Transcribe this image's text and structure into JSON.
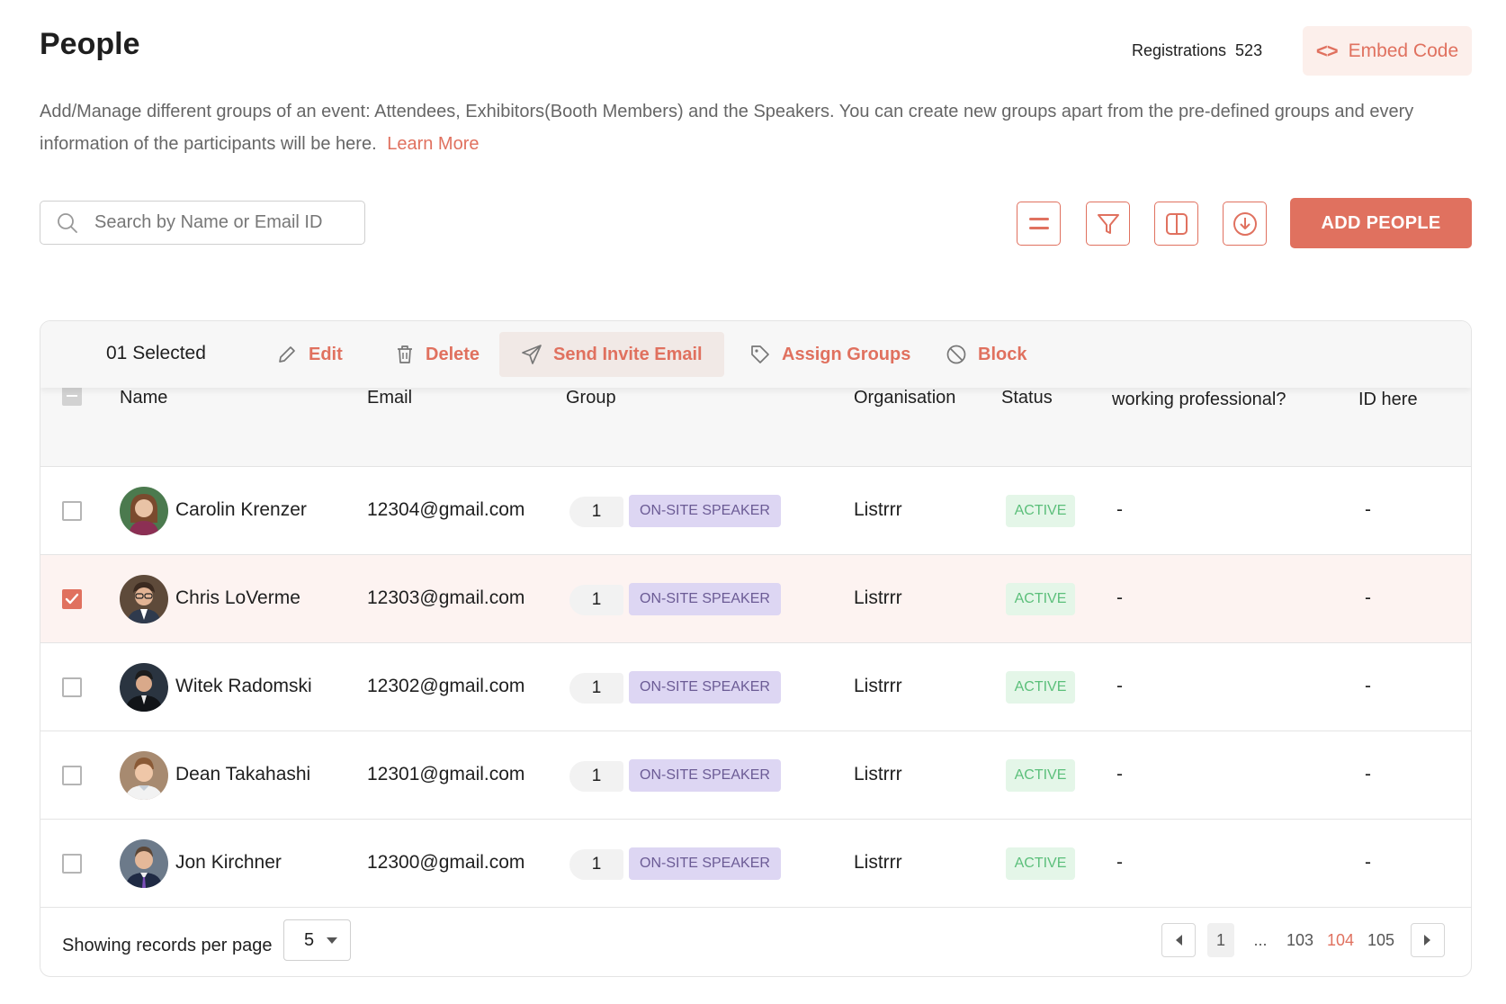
{
  "header": {
    "title": "People",
    "registrations_label": "Registrations",
    "registrations_count": "523",
    "embed_label": "Embed Code"
  },
  "description": {
    "text": "Add/Manage different groups of an event: Attendees, Exhibitors(Booth Members) and the Speakers. You can create new groups apart from the pre-defined groups and every information of the participants will be here.",
    "link": "Learn More"
  },
  "toolbar": {
    "search_placeholder": "Search by Name or Email ID",
    "icons": [
      "density-icon",
      "filter-icon",
      "columns-icon",
      "download-icon"
    ],
    "add_label": "ADD PEOPLE"
  },
  "bulk_actions": {
    "selected": "01 Selected",
    "edit": "Edit",
    "delete": "Delete",
    "send_invite": "Send Invite Email",
    "assign_groups": "Assign Groups",
    "block": "Block"
  },
  "columns": {
    "name": "Name",
    "email": "Email",
    "group": "Group",
    "organisation": "Organisation",
    "status": "Status",
    "professional": "working professional?",
    "id": "ID here"
  },
  "rows": [
    {
      "name": "Carolin Krenzer",
      "email": "12304@gmail.com",
      "group_count": "1",
      "group": "ON-SITE SPEAKER",
      "organisation": "Listrrr",
      "status": "ACTIVE",
      "professional": "-",
      "id": "-",
      "selected": false
    },
    {
      "name": "Chris LoVerme",
      "email": "12303@gmail.com",
      "group_count": "1",
      "group": "ON-SITE SPEAKER",
      "organisation": "Listrrr",
      "status": "ACTIVE",
      "professional": "-",
      "id": "-",
      "selected": true
    },
    {
      "name": "Witek Radomski",
      "email": "12302@gmail.com",
      "group_count": "1",
      "group": "ON-SITE SPEAKER",
      "organisation": "Listrrr",
      "status": "ACTIVE",
      "professional": "-",
      "id": "-",
      "selected": false
    },
    {
      "name": "Dean Takahashi",
      "email": "12301@gmail.com",
      "group_count": "1",
      "group": "ON-SITE SPEAKER",
      "organisation": "Listrrr",
      "status": "ACTIVE",
      "professional": "-",
      "id": "-",
      "selected": false
    },
    {
      "name": "Jon Kirchner",
      "email": "12300@gmail.com",
      "group_count": "1",
      "group": "ON-SITE SPEAKER",
      "organisation": "Listrrr",
      "status": "ACTIVE",
      "professional": "-",
      "id": "-",
      "selected": false
    }
  ],
  "footer": {
    "per_page_label": "Showing records per page",
    "per_page_value": "5",
    "pages": [
      "1",
      "...",
      "103",
      "104",
      "105"
    ],
    "current_page": "104"
  },
  "colors": {
    "accent": "#e0715f",
    "accent_light": "#fcefeb",
    "group_tag_bg": "#ddd6f3",
    "group_tag_text": "#6b5b95",
    "status_bg": "#e4f6e8",
    "status_text": "#5bbf7a",
    "selected_row_bg": "#fdf3f1"
  }
}
